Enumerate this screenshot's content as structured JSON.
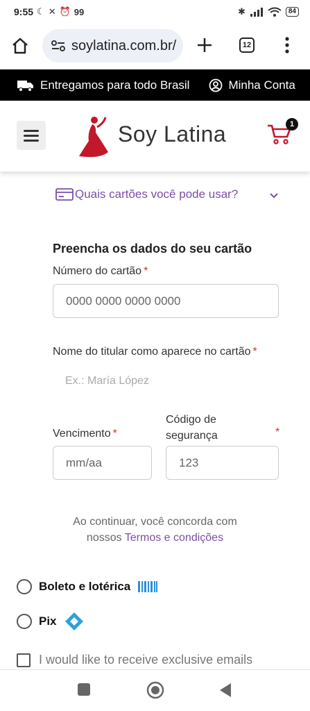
{
  "status_bar": {
    "time": "9:55",
    "notification_count": "99",
    "battery": "84"
  },
  "browser": {
    "url": "soylatina.com.br/",
    "tab_count": "12"
  },
  "promo": {
    "shipping_text": "Entregamos para todo Brasil",
    "account_text": "Minha Conta"
  },
  "header": {
    "brand": "Soy Latina",
    "cart_count": "1"
  },
  "payment": {
    "cards_link": "Quais cartões você pode usar?",
    "section_title": "Preencha os dados do seu cartão",
    "card_number_label": "Número do cartão",
    "card_number_placeholder": "0000 0000 0000 0000",
    "holder_label": "Nome do titular como aparece no cartão",
    "holder_placeholder": "Ex.: María López",
    "expiry_label": "Vencimento",
    "expiry_placeholder": "mm/aa",
    "cvv_label_line1": "Código de",
    "cvv_label_line2": "segurança",
    "cvv_placeholder": "123",
    "required_mark": "*",
    "terms_prefix": "Ao continuar, você concorda com",
    "terms_mid": "nossos ",
    "terms_link": "Termos e condições"
  },
  "methods": {
    "boleto": "Boleto e lotérica",
    "pix": "Pix"
  },
  "newsletter": {
    "label": "I would like to receive exclusive emails"
  },
  "colors": {
    "accent": "#7a4fa8",
    "required": "#c0392b",
    "brand_red": "#c2182b",
    "boleto_blue": "#2a8fd8",
    "pix_blue": "#2aa3d8"
  }
}
